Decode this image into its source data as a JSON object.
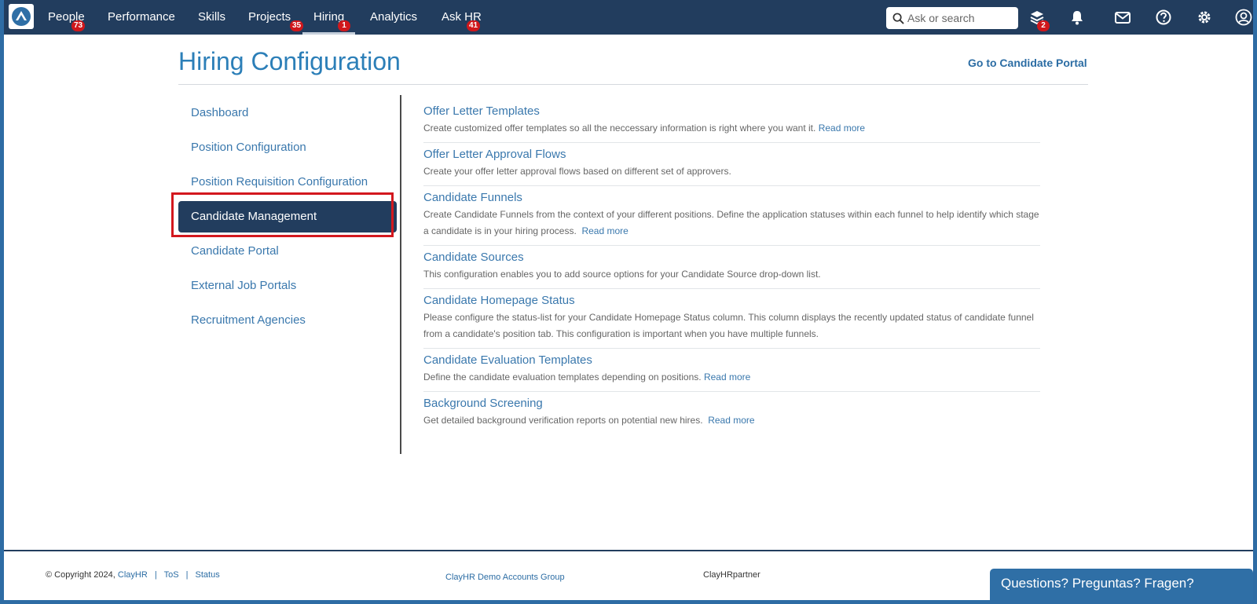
{
  "nav": {
    "items": [
      {
        "label": "People",
        "badge": "73"
      },
      {
        "label": "Performance",
        "badge": ""
      },
      {
        "label": "Skills",
        "badge": ""
      },
      {
        "label": "Projects",
        "badge": "35"
      },
      {
        "label": "Hiring",
        "badge": "1"
      },
      {
        "label": "Analytics",
        "badge": ""
      },
      {
        "label": "Ask HR",
        "badge": "41"
      }
    ],
    "active": "Hiring",
    "search_placeholder": "Ask or search",
    "learning_badge": "2",
    "icons": [
      "learning-icon",
      "bell-icon",
      "mail-icon",
      "help-icon",
      "gear-icon",
      "user-support-icon"
    ]
  },
  "header": {
    "title": "Hiring Configuration",
    "portal_link": "Go to Candidate Portal"
  },
  "sidebar": {
    "items": [
      {
        "label": "Dashboard"
      },
      {
        "label": "Position Configuration"
      },
      {
        "label": "Position Requisition Configuration"
      },
      {
        "label": "Candidate Management"
      },
      {
        "label": "Candidate Portal"
      },
      {
        "label": "External Job Portals"
      },
      {
        "label": "Recruitment Agencies"
      }
    ],
    "active": "Candidate Management"
  },
  "configs": [
    {
      "title": "Offer Letter Templates",
      "desc": "Create customized offer templates so all the neccessary information is right where you want it.",
      "read_more": "Read more"
    },
    {
      "title": "Offer Letter Approval Flows",
      "desc": "Create your offer letter approval flows based on different set of approvers.",
      "read_more": ""
    },
    {
      "title": "Candidate Funnels",
      "desc": "Create Candidate Funnels from the context of your different positions. Define the application statuses within each funnel to help identify which stage a candidate is in your hiring process.",
      "read_more": "Read more"
    },
    {
      "title": "Candidate Sources",
      "desc": "This configuration enables you to add source options for your Candidate Source drop-down list.",
      "read_more": ""
    },
    {
      "title": "Candidate Homepage Status",
      "desc": "Please configure the status-list for your Candidate Homepage Status column. This column displays the recently updated status of candidate funnel from a candidate's position tab. This configuration is important when you have multiple funnels.",
      "read_more": ""
    },
    {
      "title": "Candidate Evaluation Templates",
      "desc": "Define the candidate evaluation templates depending on positions.",
      "read_more": "Read more"
    },
    {
      "title": "Background Screening",
      "desc": "Get detailed background verification reports on potential new hires.",
      "read_more": "Read more"
    }
  ],
  "footer": {
    "copyright": "© Copyright 2024,",
    "company_link": "ClayHR",
    "tos": "ToS",
    "status": "Status",
    "separator": "|",
    "group": "ClayHR Demo Accounts Group",
    "partner": "ClayHRpartner",
    "chat": "Questions? Preguntas? Fragen?"
  },
  "colors": {
    "nav_bg": "#223d5e",
    "accent": "#2c7fb8",
    "badge": "#d0171b",
    "highlight": "#d3181e"
  }
}
